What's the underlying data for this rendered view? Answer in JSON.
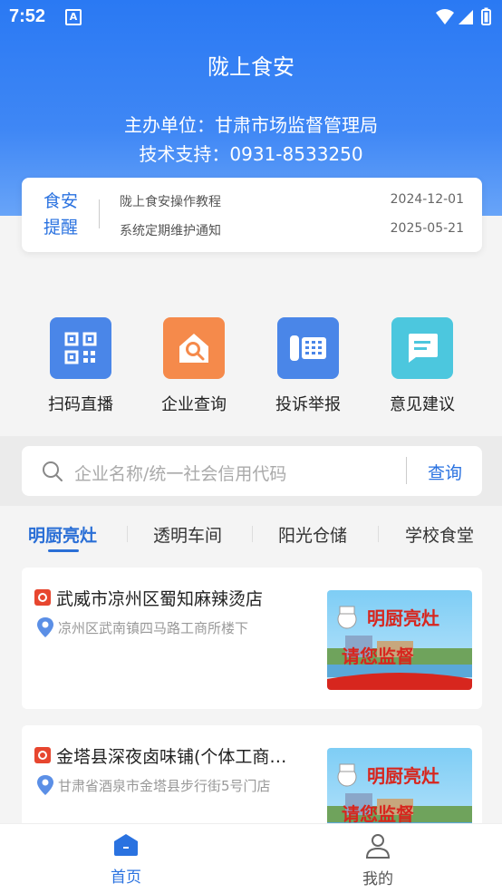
{
  "status": {
    "time": "7:52",
    "notif_icon": "A"
  },
  "header": {
    "title": "陇上食安",
    "sponsor": "主办单位：甘肃市场监督管理局",
    "support": "技术支持：0931-8533250"
  },
  "notice": {
    "tag_line1": "食安",
    "tag_line2": "提醒",
    "items": [
      {
        "title": "陇上食安操作教程",
        "date": "2024-12-01"
      },
      {
        "title": "系统定期维护通知",
        "date": "2025-05-21"
      }
    ]
  },
  "grid": [
    {
      "label": "扫码直播",
      "icon": "qr-code-icon",
      "color": "#4a86e8"
    },
    {
      "label": "企业查询",
      "icon": "house-search-icon",
      "color": "#f58a4b"
    },
    {
      "label": "投诉举报",
      "icon": "phone-icon",
      "color": "#4a86e8"
    },
    {
      "label": "意见建议",
      "icon": "message-icon",
      "color": "#4cc7de"
    }
  ],
  "search": {
    "placeholder": "企业名称/统一社会信用代码",
    "button": "查询"
  },
  "tabs": [
    "明厨亮灶",
    "透明车间",
    "阳光仓储",
    "学校食堂"
  ],
  "cards": [
    {
      "title": "武威市凉州区蜀知麻辣烫店",
      "address": "凉州区武南镇四马路工商所楼下",
      "banner_top": "明厨亮灶",
      "banner_bottom": "请您监督"
    },
    {
      "title": "金塔县深夜卤味铺(个体工商…",
      "address": "甘肃省酒泉市金塔县步行街5号门店",
      "banner_top": "明厨亮灶",
      "banner_bottom": "请您监督"
    }
  ],
  "nav": {
    "home": "首页",
    "mine": "我的"
  },
  "colors": {
    "primary": "#2a72e0",
    "header_top": "#2a79f3",
    "badge": "#e7462f"
  }
}
